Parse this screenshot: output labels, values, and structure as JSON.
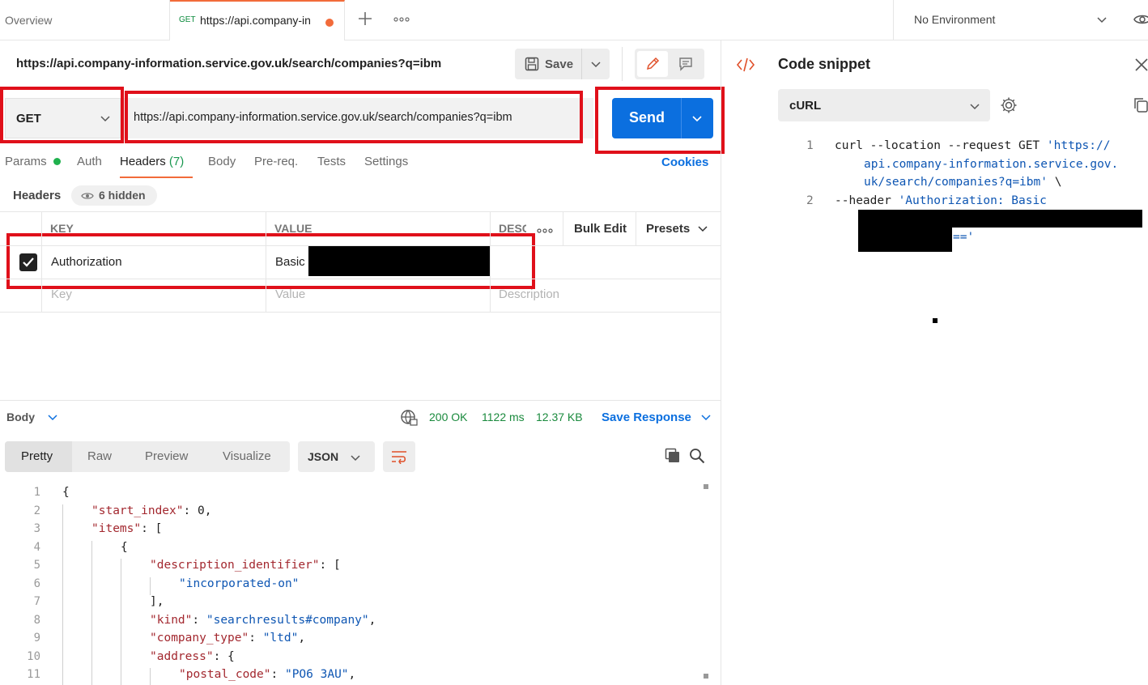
{
  "tabs": {
    "overview": "Overview",
    "active": {
      "method": "GET",
      "title": "https://api.company-in"
    },
    "new_tab_icon": "plus-icon",
    "more_icon": "ellipsis-icon"
  },
  "environment": {
    "label": "No Environment"
  },
  "request": {
    "title": "https://api.company-information.service.gov.uk/search/companies?q=ibm",
    "save_label": "Save",
    "method": "GET",
    "url": "https://api.company-information.service.gov.uk/search/companies?q=ibm",
    "send_label": "Send"
  },
  "subtabs": {
    "params": "Params",
    "auth": "Auth",
    "headers": "Headers",
    "headers_count": "(7)",
    "body": "Body",
    "prereq": "Pre-req.",
    "tests": "Tests",
    "settings": "Settings",
    "cookies": "Cookies"
  },
  "headers_section": {
    "label": "Headers",
    "hidden": "6 hidden",
    "col_key": "KEY",
    "col_value": "VALUE",
    "col_desc": "DESC",
    "bulk_edit": "Bulk Edit",
    "presets": "Presets",
    "row": {
      "key": "Authorization",
      "value": "Basic",
      "checked": true
    },
    "placeholders": {
      "key": "Key",
      "value": "Value",
      "description": "Description"
    }
  },
  "response": {
    "body_label": "Body",
    "status": "200 OK",
    "time": "1122 ms",
    "size": "12.37 KB",
    "save_response": "Save Response",
    "view_tabs": [
      "Pretty",
      "Raw",
      "Preview",
      "Visualize"
    ],
    "format": "JSON",
    "lines": [
      {
        "n": "1",
        "indent": 0,
        "parts": [
          [
            "plain",
            "{"
          ]
        ]
      },
      {
        "n": "2",
        "indent": 1,
        "parts": [
          [
            "key",
            "\"start_index\""
          ],
          [
            "plain",
            ": 0,"
          ]
        ]
      },
      {
        "n": "3",
        "indent": 1,
        "parts": [
          [
            "key",
            "\"items\""
          ],
          [
            "plain",
            ": ["
          ]
        ]
      },
      {
        "n": "4",
        "indent": 2,
        "parts": [
          [
            "plain",
            "{"
          ]
        ]
      },
      {
        "n": "5",
        "indent": 3,
        "parts": [
          [
            "key",
            "\"description_identifier\""
          ],
          [
            "plain",
            ": ["
          ]
        ]
      },
      {
        "n": "6",
        "indent": 4,
        "parts": [
          [
            "str",
            "\"incorporated-on\""
          ]
        ]
      },
      {
        "n": "7",
        "indent": 3,
        "parts": [
          [
            "plain",
            "],"
          ]
        ]
      },
      {
        "n": "8",
        "indent": 3,
        "parts": [
          [
            "key",
            "\"kind\""
          ],
          [
            "plain",
            ": "
          ],
          [
            "str",
            "\"searchresults#company\""
          ],
          [
            "plain",
            ","
          ]
        ]
      },
      {
        "n": "9",
        "indent": 3,
        "parts": [
          [
            "key",
            "\"company_type\""
          ],
          [
            "plain",
            ": "
          ],
          [
            "str",
            "\"ltd\""
          ],
          [
            "plain",
            ","
          ]
        ]
      },
      {
        "n": "10",
        "indent": 3,
        "parts": [
          [
            "key",
            "\"address\""
          ],
          [
            "plain",
            ": {"
          ]
        ]
      },
      {
        "n": "11",
        "indent": 4,
        "parts": [
          [
            "key",
            "\"postal_code\""
          ],
          [
            "plain",
            ": "
          ],
          [
            "str",
            "\"PO6 3AU\""
          ],
          [
            "plain",
            ","
          ]
        ]
      }
    ]
  },
  "snippet": {
    "title": "Code snippet",
    "language": "cURL",
    "line1_no": "1",
    "line1a": "curl --location --request GET ",
    "line1b": "'https://",
    "line1c": "api.company-information.service.gov.",
    "line1d": "uk/search/companies?q=ibm'",
    "line1e": " \\",
    "line2_no": "2",
    "line2a": "--header ",
    "line2b": "'Authorization: Basic",
    "line2c": "=='"
  }
}
